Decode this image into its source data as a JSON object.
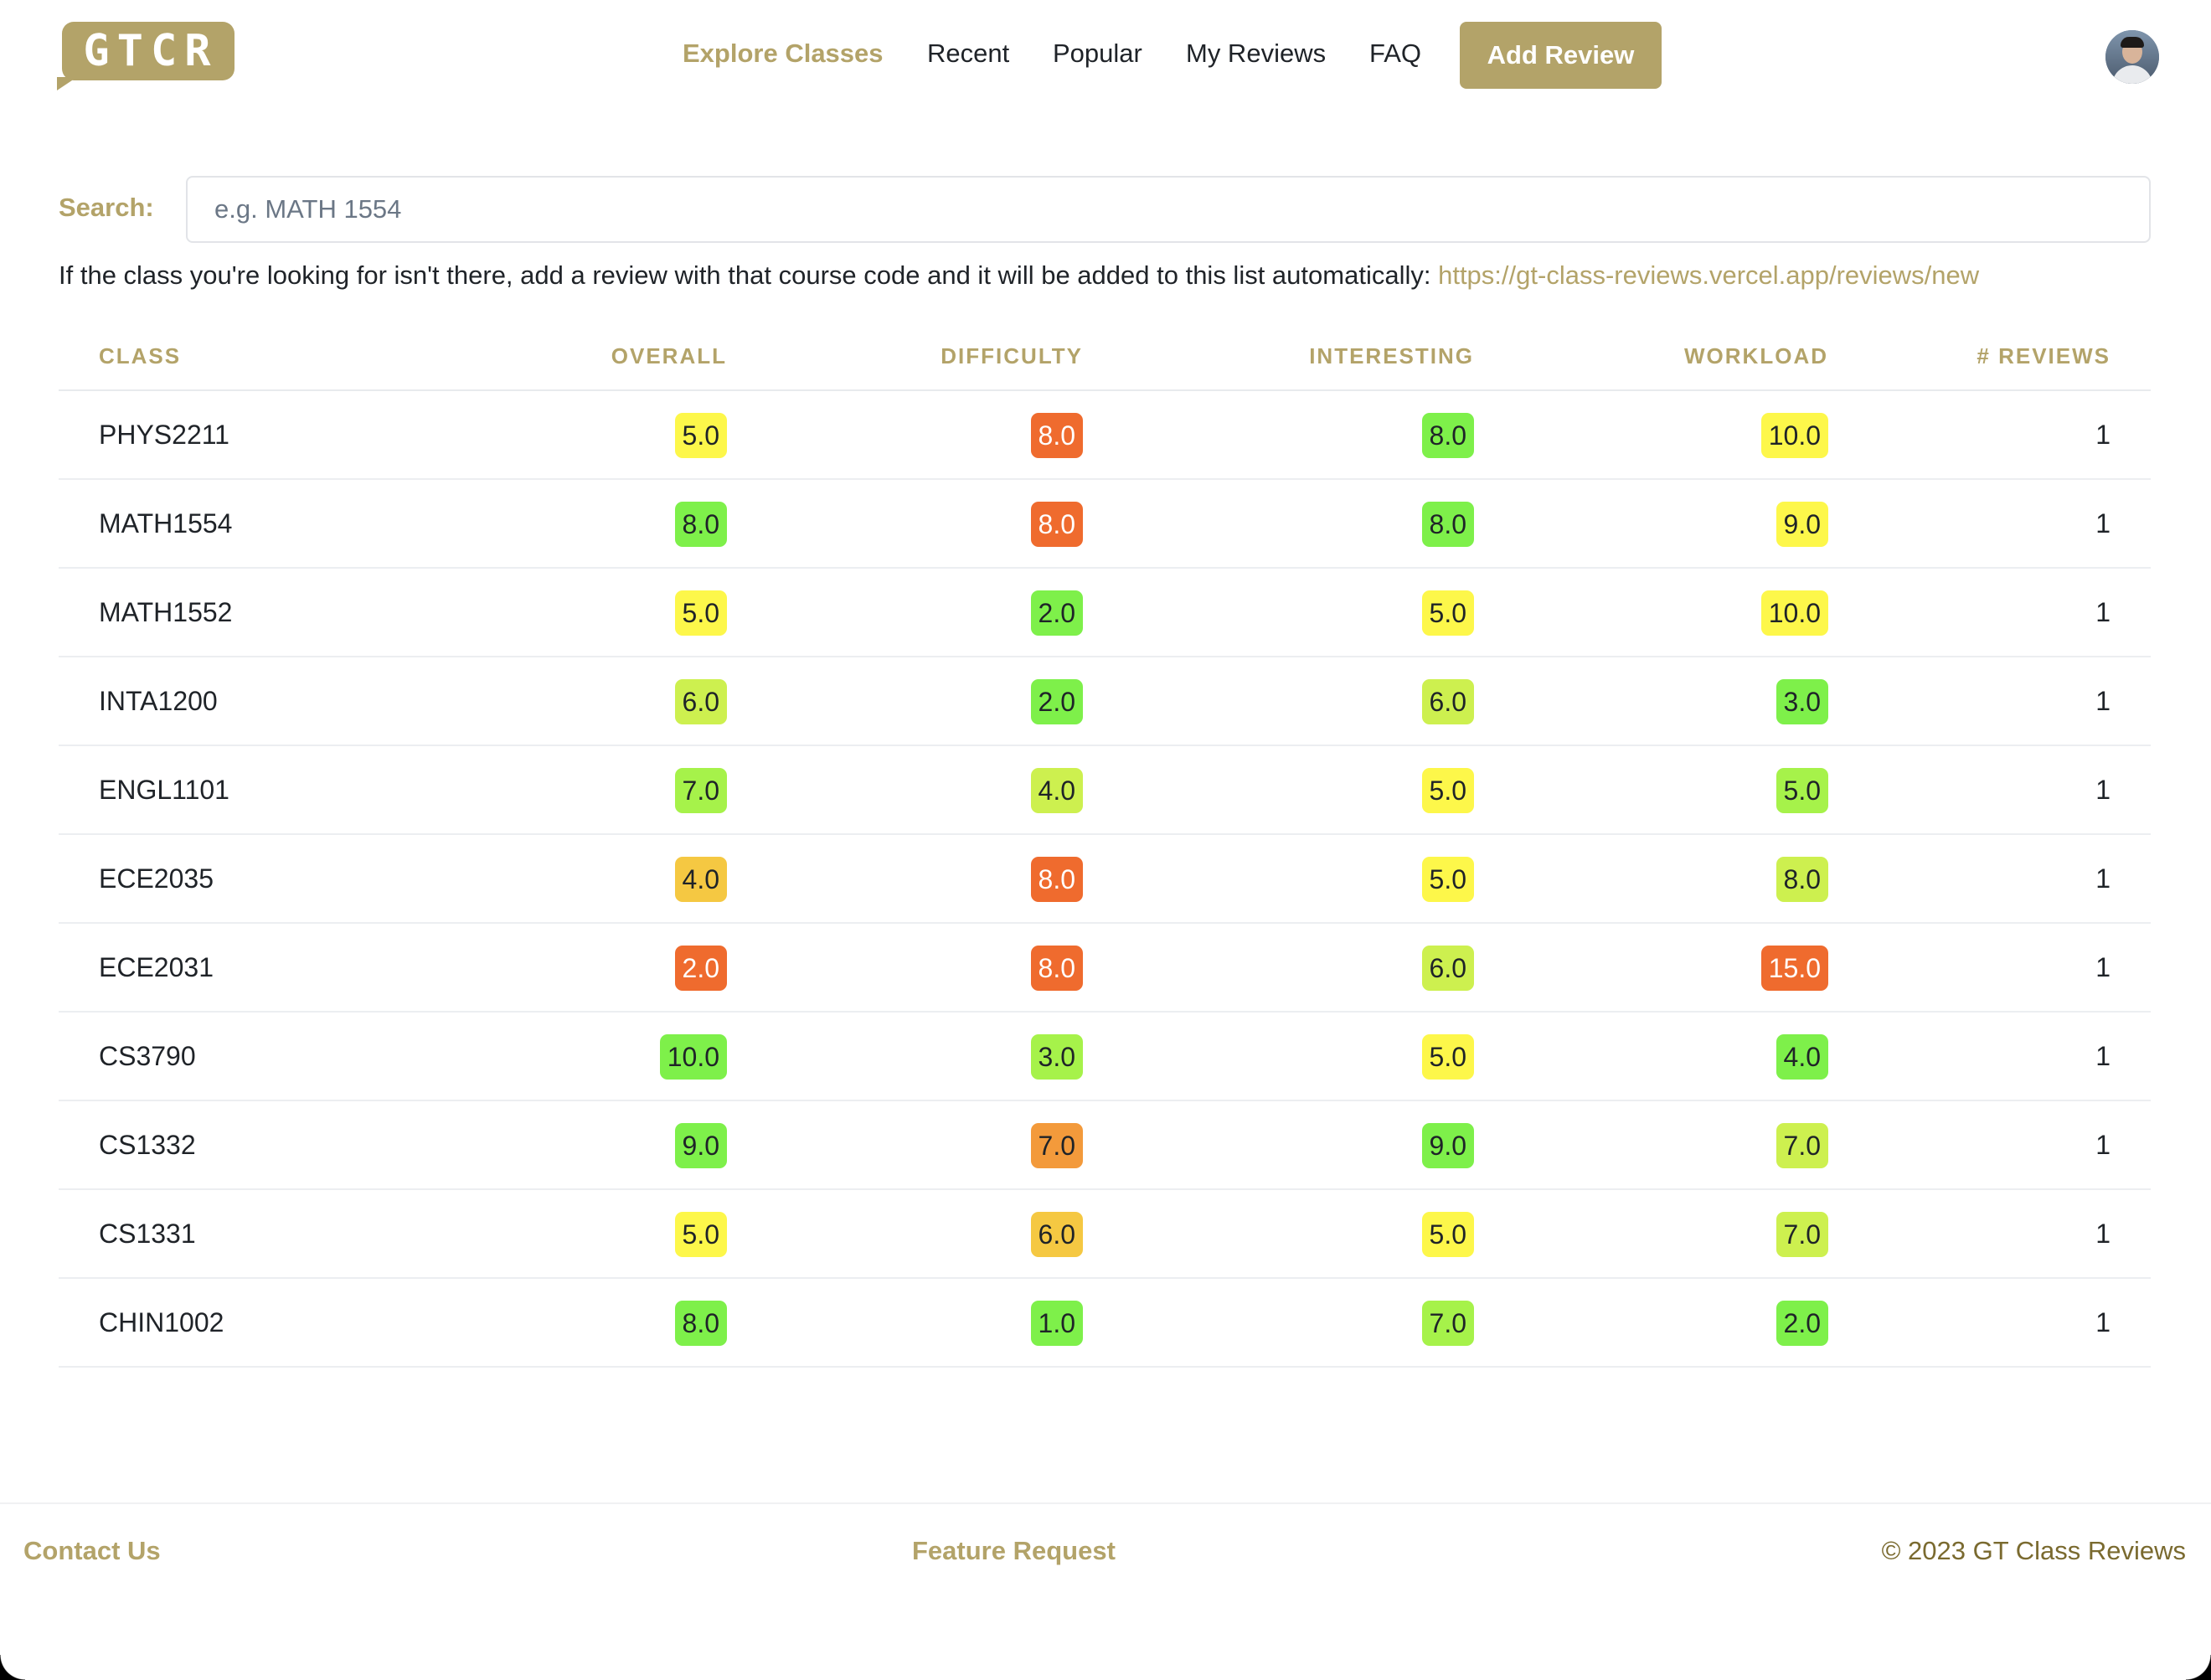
{
  "brand": {
    "logo_text": "GTCR",
    "color": "#b3a369"
  },
  "nav": {
    "items": [
      {
        "label": "Explore Classes",
        "active": true
      },
      {
        "label": "Recent",
        "active": false
      },
      {
        "label": "Popular",
        "active": false
      },
      {
        "label": "My Reviews",
        "active": false
      },
      {
        "label": "FAQ",
        "active": false
      }
    ],
    "add_review_label": "Add Review"
  },
  "search": {
    "label": "Search:",
    "placeholder": "e.g. MATH 1554",
    "value": ""
  },
  "hint": {
    "text": "If the class you're looking for isn't there, add a review with that course code and it will be added to this list automatically:",
    "link": "https://gt-class-reviews.vercel.app/reviews/new"
  },
  "table": {
    "columns": [
      "CLASS",
      "OVERALL",
      "DIFFICULTY",
      "INTERESTING",
      "WORKLOAD",
      "# REVIEWS"
    ],
    "rows": [
      {
        "class": "PHYS2211",
        "overall": "5.0",
        "difficulty": "8.0",
        "interesting": "8.0",
        "workload": "10.0",
        "reviews": "1"
      },
      {
        "class": "MATH1554",
        "overall": "8.0",
        "difficulty": "8.0",
        "interesting": "8.0",
        "workload": "9.0",
        "reviews": "1"
      },
      {
        "class": "MATH1552",
        "overall": "5.0",
        "difficulty": "2.0",
        "interesting": "5.0",
        "workload": "10.0",
        "reviews": "1"
      },
      {
        "class": "INTA1200",
        "overall": "6.0",
        "difficulty": "2.0",
        "interesting": "6.0",
        "workload": "3.0",
        "reviews": "1"
      },
      {
        "class": "ENGL1101",
        "overall": "7.0",
        "difficulty": "4.0",
        "interesting": "5.0",
        "workload": "5.0",
        "reviews": "1"
      },
      {
        "class": "ECE2035",
        "overall": "4.0",
        "difficulty": "8.0",
        "interesting": "5.0",
        "workload": "8.0",
        "reviews": "1"
      },
      {
        "class": "ECE2031",
        "overall": "2.0",
        "difficulty": "8.0",
        "interesting": "6.0",
        "workload": "15.0",
        "reviews": "1"
      },
      {
        "class": "CS3790",
        "overall": "10.0",
        "difficulty": "3.0",
        "interesting": "5.0",
        "workload": "4.0",
        "reviews": "1"
      },
      {
        "class": "CS1332",
        "overall": "9.0",
        "difficulty": "7.0",
        "interesting": "9.0",
        "workload": "7.0",
        "reviews": "1"
      },
      {
        "class": "CS1331",
        "overall": "5.0",
        "difficulty": "6.0",
        "interesting": "5.0",
        "workload": "7.0",
        "reviews": "1"
      },
      {
        "class": "CHIN1002",
        "overall": "8.0",
        "difficulty": "1.0",
        "interesting": "7.0",
        "workload": "2.0",
        "reviews": "1"
      }
    ],
    "score_colors": {
      "green": "#7ef04a",
      "lime": "#a6f24a",
      "yellow_green": "#cdf04f",
      "yellow": "#fdf74a",
      "amber": "#f5c842",
      "orange": "#f39a3b",
      "red_orange": "#ef6b2e"
    },
    "score_color_map": {
      "overall": [
        "yellow",
        "green",
        "yellow",
        "yellow_green",
        "lime",
        "amber",
        "red_orange",
        "green",
        "green",
        "yellow",
        "green"
      ],
      "difficulty": [
        "red_orange",
        "red_orange",
        "green",
        "green",
        "yellow_green",
        "red_orange",
        "red_orange",
        "lime",
        "orange",
        "amber",
        "green"
      ],
      "interesting": [
        "green",
        "green",
        "yellow",
        "yellow_green",
        "yellow",
        "yellow",
        "yellow_green",
        "yellow",
        "green",
        "yellow",
        "lime"
      ],
      "workload": [
        "yellow",
        "yellow",
        "yellow",
        "green",
        "lime",
        "yellow_green",
        "red_orange",
        "green",
        "yellow_green",
        "yellow_green",
        "green"
      ]
    }
  },
  "footer": {
    "contact": "Contact Us",
    "feature_request": "Feature Request",
    "copyright": "© 2023 GT Class Reviews"
  }
}
